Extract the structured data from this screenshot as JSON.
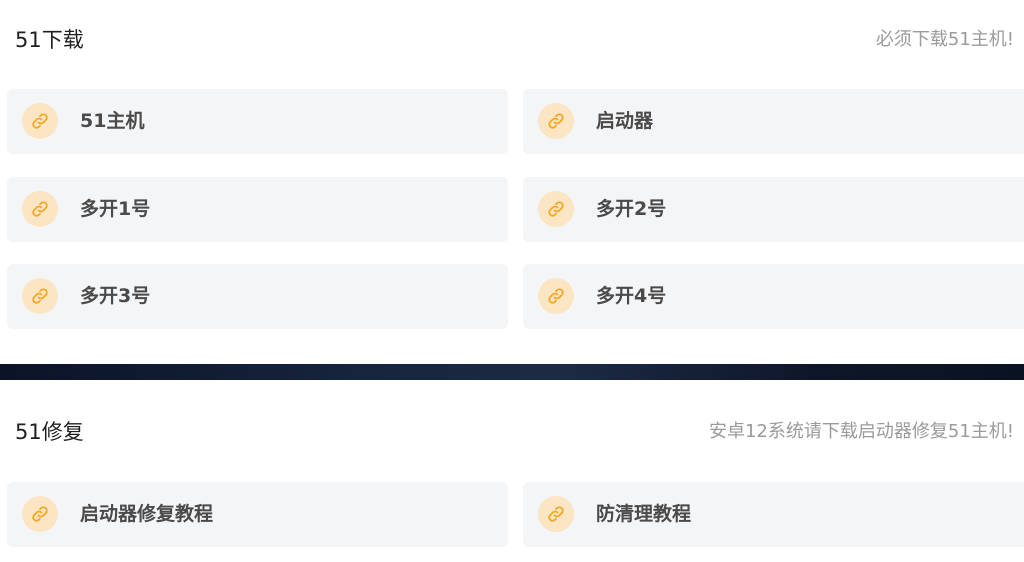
{
  "download": {
    "title": "51下载",
    "note": "必须下载51主机!",
    "items": [
      {
        "label": "51主机",
        "icon": "link-icon"
      },
      {
        "label": "启动器",
        "icon": "link-icon"
      },
      {
        "label": "多开1号",
        "icon": "link-icon"
      },
      {
        "label": "多开2号",
        "icon": "link-icon"
      },
      {
        "label": "多开3号",
        "icon": "link-icon"
      },
      {
        "label": "多开4号",
        "icon": "link-icon"
      }
    ]
  },
  "repair": {
    "title": "51修复",
    "note": "安卓12系统请下载启动器修复51主机!",
    "items": [
      {
        "label": "启动器修复教程",
        "icon": "link-icon"
      },
      {
        "label": "防清理教程",
        "icon": "link-icon"
      }
    ]
  },
  "colors": {
    "icon_accent": "#f5a623",
    "icon_bg": "#fbe5c2",
    "tile_bg": "#f4f5f7",
    "divider": "#16243d"
  }
}
